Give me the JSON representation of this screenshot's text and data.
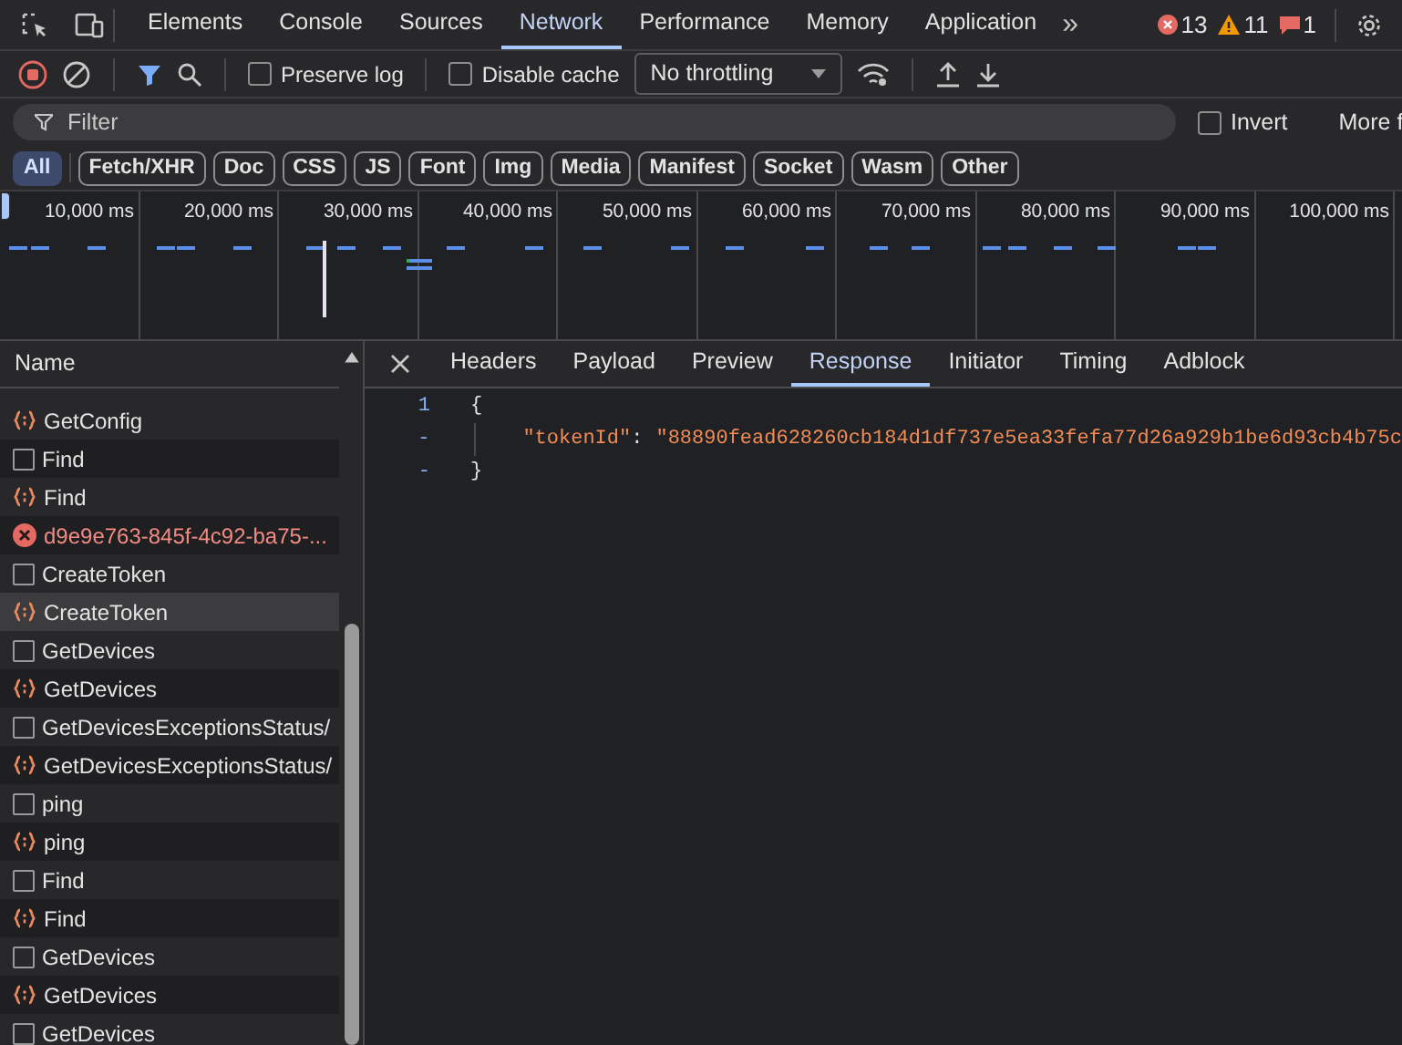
{
  "main_tabs": [
    {
      "label": "Elements",
      "selected": false
    },
    {
      "label": "Console",
      "selected": false
    },
    {
      "label": "Sources",
      "selected": false
    },
    {
      "label": "Network",
      "selected": true
    },
    {
      "label": "Performance",
      "selected": false
    },
    {
      "label": "Memory",
      "selected": false
    },
    {
      "label": "Application",
      "selected": false
    }
  ],
  "more_tabs": "»",
  "counters": {
    "errors": "13",
    "warnings": "11",
    "messages": "1"
  },
  "toolbar": {
    "recording": true,
    "preserve_log": {
      "label": "Preserve log",
      "checked": false
    },
    "disable_cache": {
      "label": "Disable cache",
      "checked": false
    },
    "throttling": "No throttling"
  },
  "filter": {
    "placeholder": "Filter",
    "invert": {
      "label": "Invert",
      "checked": false
    },
    "more": "More f"
  },
  "type_filters": [
    {
      "label": "All",
      "selected": true
    },
    {
      "label": "Fetch/XHR",
      "selected": false
    },
    {
      "label": "Doc",
      "selected": false
    },
    {
      "label": "CSS",
      "selected": false
    },
    {
      "label": "JS",
      "selected": false
    },
    {
      "label": "Font",
      "selected": false
    },
    {
      "label": "Img",
      "selected": false
    },
    {
      "label": "Media",
      "selected": false
    },
    {
      "label": "Manifest",
      "selected": false
    },
    {
      "label": "Socket",
      "selected": false
    },
    {
      "label": "Wasm",
      "selected": false
    },
    {
      "label": "Other",
      "selected": false
    }
  ],
  "timeline_ticks": [
    "10,000 ms",
    "20,000 ms",
    "30,000 ms",
    "40,000 ms",
    "50,000 ms",
    "60,000 ms",
    "70,000 ms",
    "80,000 ms",
    "90,000 ms",
    "100,000 ms"
  ],
  "requests": {
    "column": "Name",
    "rows": [
      {
        "name": "GetConfig",
        "kind": "fetch",
        "selected": false
      },
      {
        "name": "Find",
        "kind": "doc",
        "selected": false
      },
      {
        "name": "Find",
        "kind": "fetch",
        "selected": false
      },
      {
        "name": "d9e9e763-845f-4c92-ba75-...",
        "kind": "error",
        "selected": false
      },
      {
        "name": "CreateToken",
        "kind": "doc",
        "selected": false
      },
      {
        "name": "CreateToken",
        "kind": "fetch",
        "selected": true
      },
      {
        "name": "GetDevices",
        "kind": "doc",
        "selected": false
      },
      {
        "name": "GetDevices",
        "kind": "fetch",
        "selected": false
      },
      {
        "name": "GetDevicesExceptionsStatus/",
        "kind": "doc",
        "selected": false
      },
      {
        "name": "GetDevicesExceptionsStatus/",
        "kind": "fetch",
        "selected": false
      },
      {
        "name": "ping",
        "kind": "doc",
        "selected": false
      },
      {
        "name": "ping",
        "kind": "fetch",
        "selected": false
      },
      {
        "name": "Find",
        "kind": "doc",
        "selected": false
      },
      {
        "name": "Find",
        "kind": "fetch",
        "selected": false
      },
      {
        "name": "GetDevices",
        "kind": "doc",
        "selected": false
      },
      {
        "name": "GetDevices",
        "kind": "fetch",
        "selected": false
      },
      {
        "name": "GetDevices",
        "kind": "doc",
        "selected": false
      }
    ]
  },
  "detail_tabs": [
    {
      "label": "Headers",
      "selected": false
    },
    {
      "label": "Payload",
      "selected": false
    },
    {
      "label": "Preview",
      "selected": false
    },
    {
      "label": "Response",
      "selected": true
    },
    {
      "label": "Initiator",
      "selected": false
    },
    {
      "label": "Timing",
      "selected": false
    },
    {
      "label": "Adblock",
      "selected": false
    }
  ],
  "response": [
    {
      "gutter": "1",
      "kind": "brace",
      "text": "{"
    },
    {
      "gutter": "-",
      "kind": "pair",
      "key": "\"tokenId\"",
      "sep": ":",
      "value": "\"88890fead628260cb184d1df737e5ea33fefa77d26a929b1be6d93cb4b75c"
    },
    {
      "gutter": "-",
      "kind": "brace",
      "text": "}"
    }
  ]
}
